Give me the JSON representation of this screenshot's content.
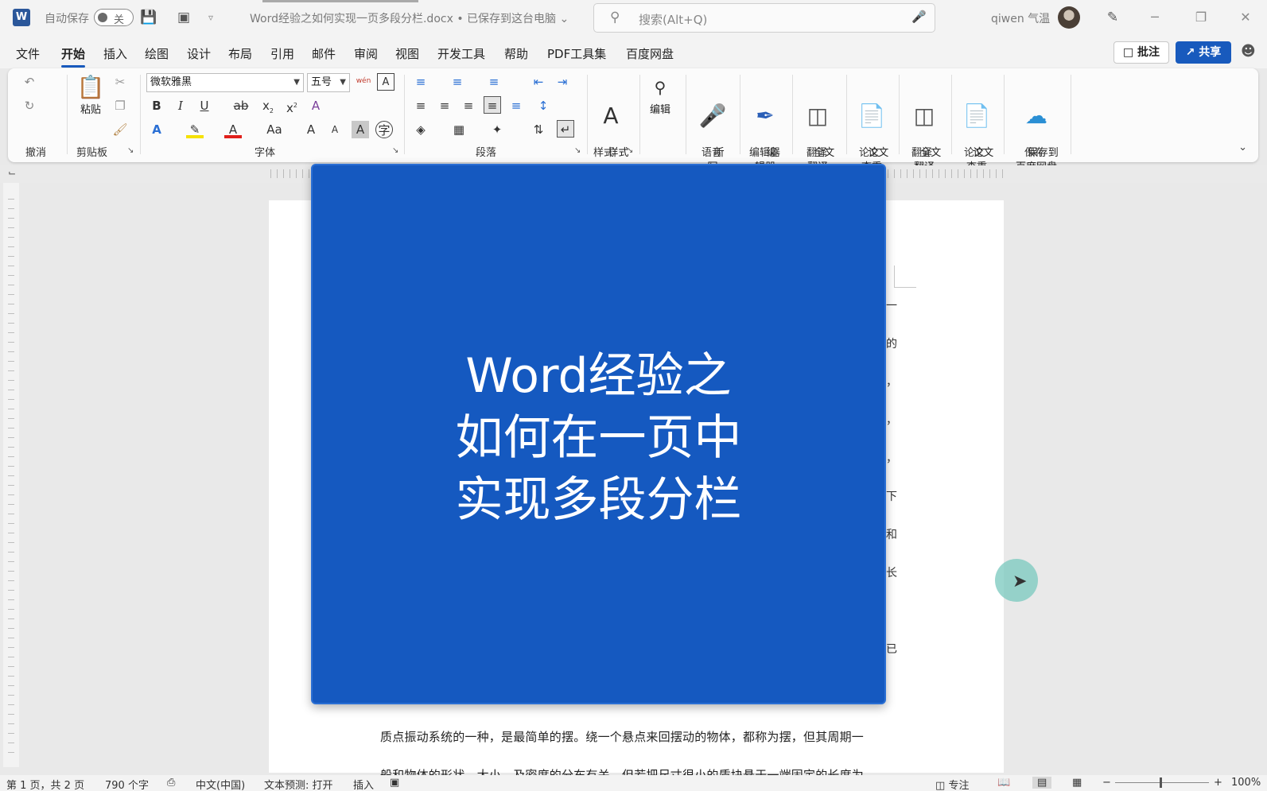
{
  "titlebar": {
    "logo": "W",
    "autosave_label": "自动保存",
    "autosave_state": "关",
    "doc_title": "Word经验之如何实现一页多段分栏.docx • 已保存到这台电脑",
    "doc_title_caret": "⌄",
    "search_placeholder": "搜索(Alt+Q)",
    "user_name": "qiwen 气温",
    "icons": [
      "save-icon",
      "presenter-icon",
      "customize-icon",
      "search-icon",
      "mic-icon",
      "pen-icon"
    ]
  },
  "window_controls": {
    "minimize": "─",
    "restore": "❐",
    "close": "✕"
  },
  "menu": {
    "tabs": [
      "文件",
      "开始",
      "插入",
      "绘图",
      "设计",
      "布局",
      "引用",
      "邮件",
      "审阅",
      "视图",
      "开发工具",
      "帮助",
      "PDF工具集",
      "百度网盘"
    ],
    "active_tab": "开始",
    "comment_label": "批注",
    "share_label": "共享"
  },
  "ribbon": {
    "groups": {
      "undo": "撤消",
      "clipboard": "剪贴板",
      "font": "字体",
      "paragraph": "段落",
      "styles": "样式",
      "voice": "语音",
      "editor": "编辑器",
      "translate1": "翻译",
      "paper1": "论文",
      "translate2": "翻译",
      "paper2": "论文",
      "save": "保存"
    },
    "paste_label": "粘贴",
    "font_name": "微软雅黑",
    "font_size": "五号",
    "wen": "wén",
    "bold": "B",
    "italic": "I",
    "underline": "U",
    "strike": "ab",
    "sub": "x",
    "sup": "x",
    "aa": "Aa",
    "grow": "A",
    "shrink": "A",
    "styles_label": "样式",
    "edit_label": "编辑",
    "dictate_label": "听\n写",
    "editor_label": "编\n辑器",
    "fulltrans1_label": "全文\n翻译",
    "papercheck1_label": "论文\n查重",
    "fulltrans2_label": "全文\n翻译",
    "papercheck2_label": "论文\n查重",
    "baidu_label": "保存到\n百度网盘",
    "accent": "#185abd"
  },
  "document": {
    "edge_chars": [
      "一",
      "的",
      "，",
      "，",
      "，",
      "下",
      "和",
      "长",
      "已"
    ],
    "line1": "质点振动系统的一种，是最简单的摆。绕一个悬点来回摆动的物体，都称为摆，但其周期一",
    "line2": "般和物体的形状、大小、及密度的分布有关。但若把尺寸很小的质块悬于一端固定的长度为"
  },
  "overlay": {
    "line1": "Word经验之",
    "line2": "如何在一页中",
    "line3": "实现多段分栏",
    "bg": "#1559c0"
  },
  "statusbar": {
    "page_info": "第 1 页，共 2 页",
    "word_count": "790 个字",
    "language": "中文(中国)",
    "text_prediction": "文本预测: 打开",
    "insert_mode": "插入",
    "focus_label": "专注",
    "zoom_minus": "−",
    "zoom_plus": "+",
    "zoom_level": "100%"
  }
}
